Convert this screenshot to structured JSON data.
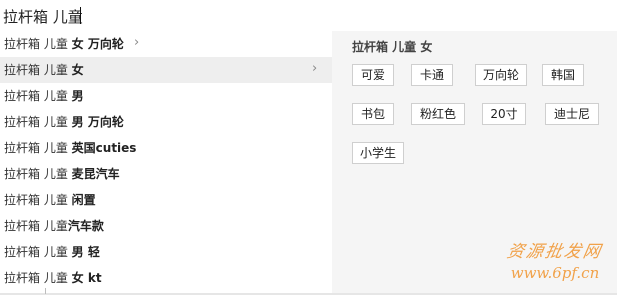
{
  "search": {
    "value": "拉杆箱 儿童"
  },
  "suggestions": [
    {
      "query": "拉杆箱 儿童",
      "suffix": "女 万向轮"
    },
    {
      "query": "拉杆箱 儿童",
      "suffix": "女"
    },
    {
      "query": "拉杆箱 儿童",
      "suffix": "男"
    },
    {
      "query": "拉杆箱 儿童",
      "suffix": "男 万向轮"
    },
    {
      "query": "拉杆箱 儿童",
      "suffix": "英国cuties"
    },
    {
      "query": "拉杆箱 儿童",
      "suffix": "麦昆汽车"
    },
    {
      "query": "拉杆箱 儿童",
      "suffix": "闲置"
    },
    {
      "query": "拉杆箱 儿童",
      "suffix": "汽车款"
    },
    {
      "query": "拉杆箱 儿童",
      "suffix": "男 轻"
    },
    {
      "query": "拉杆箱 儿童",
      "suffix": "女 kt"
    }
  ],
  "selected_index": 1,
  "panel": {
    "title": "拉杆箱 儿童 女",
    "tags": [
      "可爱",
      "卡通",
      "万向轮",
      "韩国",
      "书包",
      "粉红色",
      "20寸",
      "迪士尼",
      "小学生"
    ]
  },
  "watermark": {
    "title": "资源批发网",
    "url": "www.6pf.cn"
  }
}
